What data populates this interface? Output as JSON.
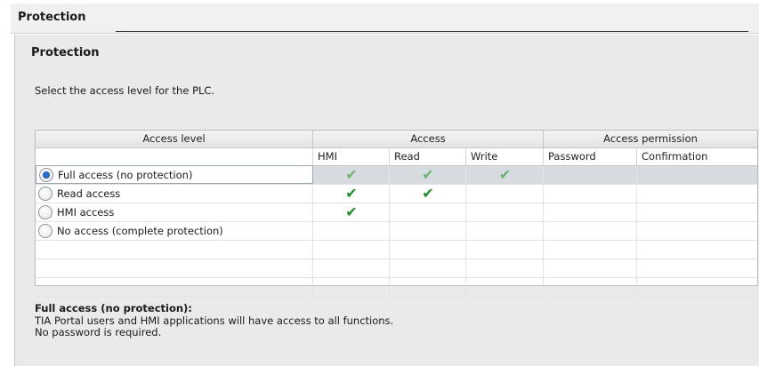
{
  "outer_header": {
    "title": "Protection"
  },
  "panel": {
    "title": "Protection",
    "description": "Select the access level for the PLC."
  },
  "table": {
    "headers": {
      "access_level": "Access level",
      "access": "Access",
      "access_permission": "Access permission"
    },
    "subheaders": {
      "hmi": "HMI",
      "read": "Read",
      "write": "Write",
      "password": "Password",
      "confirmation": "Confirmation"
    },
    "rows": [
      {
        "label": "Full access (no protection)",
        "selected": true,
        "hmi": true,
        "read": true,
        "write": true
      },
      {
        "label": "Read access",
        "selected": false,
        "hmi": true,
        "read": true,
        "write": false
      },
      {
        "label": "HMI access",
        "selected": false,
        "hmi": true,
        "read": false,
        "write": false
      },
      {
        "label": "No access (complete protection)",
        "selected": false,
        "hmi": false,
        "read": false,
        "write": false
      }
    ],
    "check_glyph": "✔",
    "check_color_selected": "#6fb372",
    "check_color_normal": "#1e8a2a"
  },
  "info": {
    "title": "Full access (no protection):",
    "line1": "TIA Portal users and HMI applications will have access to all functions.",
    "line2": "No password is required."
  }
}
